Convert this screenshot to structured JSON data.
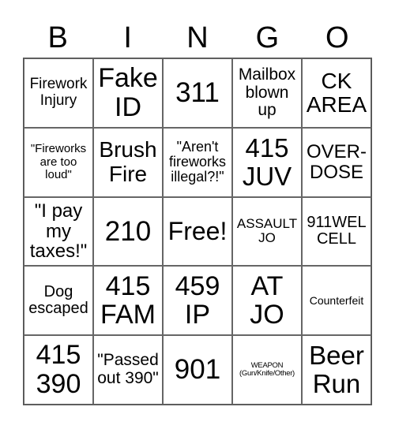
{
  "header": [
    "B",
    "I",
    "N",
    "G",
    "O"
  ],
  "cells": [
    "Firework\nInjury",
    "Fake\nID",
    "311",
    "Mailbox\nblown\nup",
    "CK\nAREA",
    "\"Fireworks\nare too\nloud\"",
    "Brush\nFire",
    "\"Aren't\nfireworks\nillegal?!\"",
    "415\nJUV",
    "OVER-\nDOSE",
    "\"I pay\nmy\ntaxes!\"",
    "210",
    "Free!",
    "ASSAULT\nJO",
    "911WEL\nCELL",
    "Dog\nescaped",
    "415\nFAM",
    "459\nIP",
    "AT\nJO",
    "Counterfeit",
    "415\n390",
    "\"Passed\nout 390\"",
    "901",
    "WEAPON\n(Gun/Knife/Other)",
    "Beer\nRun"
  ]
}
